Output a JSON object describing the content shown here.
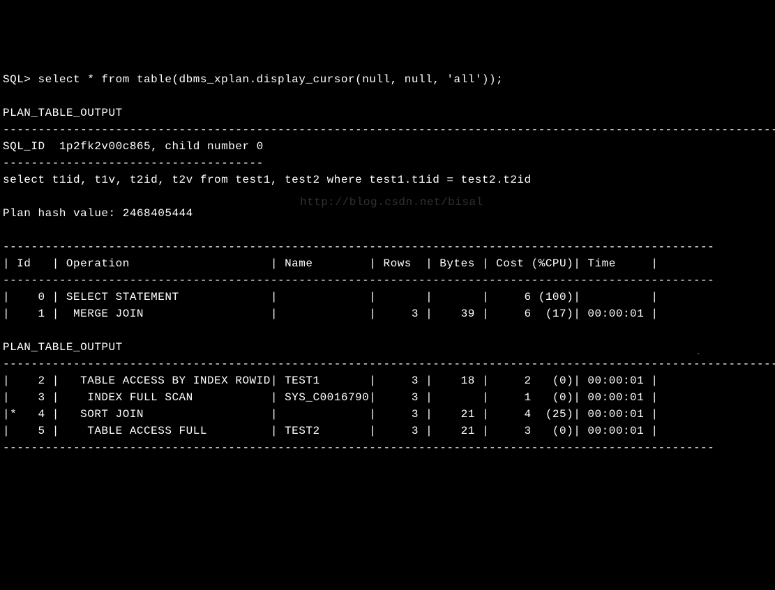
{
  "prompt": "SQL> ",
  "query": "select * from table(dbms_xplan.display_cursor(null, null, 'all'));",
  "output_header": "PLAN_TABLE_OUTPUT",
  "dashline_full": "--------------------------------------------------------------------------------------------------------------",
  "sql_id_line": "SQL_ID  1p2fk2v00c865, child number 0",
  "dashline_short": "-------------------------------------",
  "statement": "select t1id, t1v, t2id, t2v from test1, test2 where test1.t1id = test2.t2id",
  "plan_hash_line": "Plan hash value: 2468405444",
  "table_border": "-----------------------------------------------------------------------------------------------------",
  "columns": {
    "id": "Id",
    "operation": "Operation",
    "name": "Name",
    "rows": "Rows",
    "bytes": "Bytes",
    "cost": "Cost (%CPU)",
    "time": "Time"
  },
  "plan_rows": [
    {
      "star": " ",
      "id": "0",
      "operation": "SELECT STATEMENT",
      "name": "",
      "rows": "",
      "bytes": "",
      "cost": "6",
      "cpu": "(100)",
      "time": ""
    },
    {
      "star": " ",
      "id": "1",
      "operation": " MERGE JOIN",
      "name": "",
      "rows": "3",
      "bytes": "39",
      "cost": "6",
      "cpu": " (17)",
      "time": "00:00:01"
    },
    {
      "star": " ",
      "id": "2",
      "operation": "  TABLE ACCESS BY INDEX ROWID",
      "name": "TEST1",
      "rows": "3",
      "bytes": "18",
      "cost": "2",
      "cpu": "  (0)",
      "time": "00:00:01"
    },
    {
      "star": " ",
      "id": "3",
      "operation": "   INDEX FULL SCAN",
      "name": "SYS_C0016790",
      "rows": "3",
      "bytes": "",
      "cost": "1",
      "cpu": "  (0)",
      "time": "00:00:01"
    },
    {
      "star": "*",
      "id": "4",
      "operation": "  SORT JOIN",
      "name": "",
      "rows": "3",
      "bytes": "21",
      "cost": "4",
      "cpu": " (25)",
      "time": "00:00:01"
    },
    {
      "star": " ",
      "id": "5",
      "operation": "   TABLE ACCESS FULL",
      "name": "TEST2",
      "rows": "3",
      "bytes": "21",
      "cost": "3",
      "cpu": "  (0)",
      "time": "00:00:01"
    }
  ],
  "watermark": "http://blog.csdn.net/bisal"
}
